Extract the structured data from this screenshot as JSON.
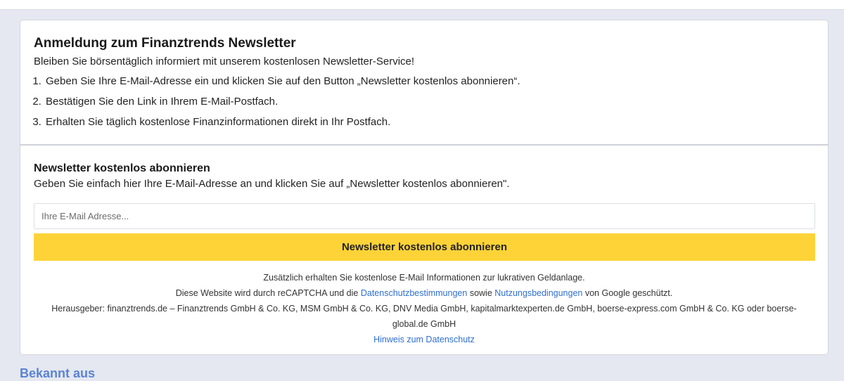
{
  "intro": {
    "title": "Anmeldung zum Finanztrends Newsletter",
    "subtitle": "Bleiben Sie börsentäglich informiert mit unserem kostenlosen Newsletter-Service!",
    "steps": [
      "Geben Sie Ihre E-Mail-Adresse ein und klicken Sie auf den Button „Newsletter kostenlos abonnieren“.",
      "Bestätigen Sie den Link in Ihrem E-Mail-Postfach.",
      "Erhalten Sie täglich kostenlose Finanzinformationen direkt in Ihr Postfach."
    ]
  },
  "form": {
    "title": "Newsletter kostenlos abonnieren",
    "subtitle": "Geben Sie einfach hier Ihre E-Mail-Adresse an und klicken Sie auf „Newsletter kostenlos abonnieren\".",
    "email_placeholder": "Ihre E-Mail Adresse...",
    "email_value": "",
    "submit_label": "Newsletter kostenlos abonnieren",
    "button_color": "#fdd338"
  },
  "fineprint": {
    "line1": "Zusätzlich erhalten Sie kostenlose E-Mail Informationen zur lukrativen Geldanlage.",
    "recaptcha_prefix": "Diese Website wird durch reCAPTCHA und die",
    "privacy_link": "Datenschutzbestimmungen",
    "recaptcha_middle": "sowie",
    "terms_link": "Nutzungsbedingungen",
    "recaptcha_suffix": "von Google geschützt.",
    "publisher": "Herausgeber: finanztrends.de – Finanztrends GmbH & Co. KG, MSM GmbH & Co. KG, DNV Media GmbH, kapitalmarktexperten.de GmbH, boerse-express.com GmbH & Co. KG oder boerse-global.de GmbH",
    "privacy_notice_link": "Hinweis zum Datenschutz",
    "link_color": "#2f6fcf"
  },
  "below": {
    "heading_partial": "Bekannt aus"
  }
}
